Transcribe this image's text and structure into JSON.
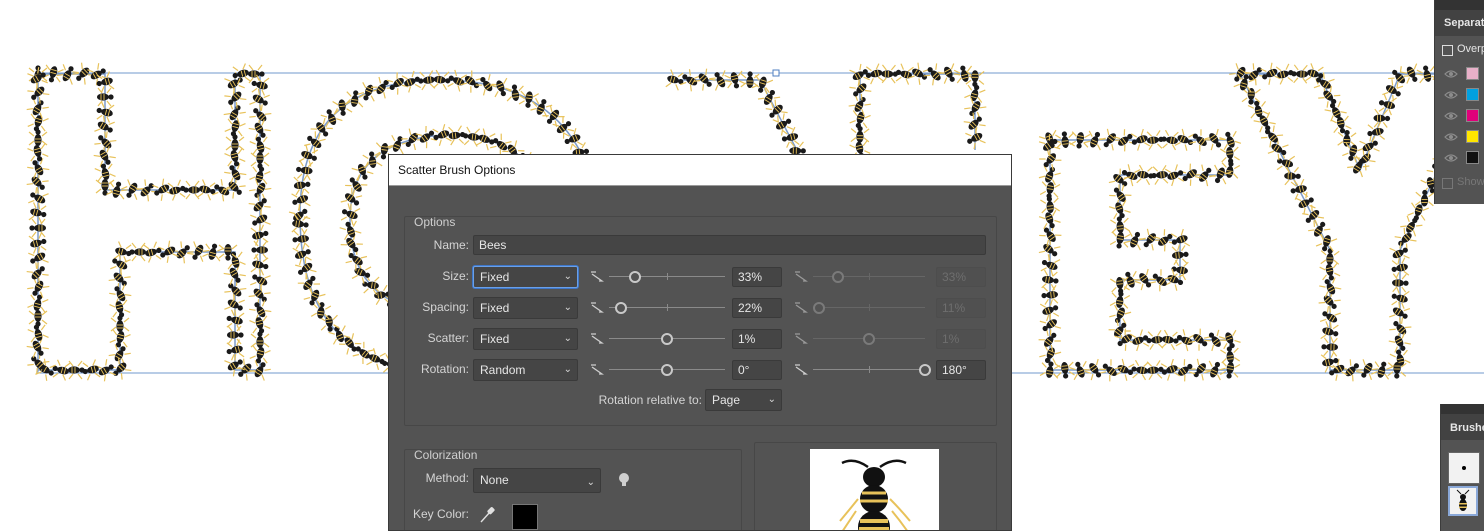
{
  "artwork": {
    "text": "HONEY",
    "stroke_color": "#7d9cc9",
    "bee_color": "#1a1a1a",
    "wing_color": "#e8c25a"
  },
  "dialog": {
    "title": "Scatter Brush Options",
    "options_group": {
      "title": "Options",
      "name_label": "Name:",
      "name_value": "Bees",
      "rows": [
        {
          "label": "Size:",
          "mode": "Fixed",
          "min_value": "33%",
          "max_value": "33%",
          "min_level": 0.22,
          "max_level": 0.22
        },
        {
          "label": "Spacing:",
          "mode": "Fixed",
          "min_value": "22%",
          "max_value": "11%",
          "min_level": 0.1,
          "max_level": 0.05
        },
        {
          "label": "Scatter:",
          "mode": "Fixed",
          "min_value": "1%",
          "max_value": "1%",
          "min_level": 0.5,
          "max_level": 0.5
        },
        {
          "label": "Rotation:",
          "mode": "Random",
          "min_value": "0°",
          "max_value": "180°",
          "min_level": 0.5,
          "max_level": 1.0
        }
      ],
      "rotation_relative_label": "Rotation relative to:",
      "rotation_relative_value": "Page"
    },
    "colorization_group": {
      "title": "Colorization",
      "method_label": "Method:",
      "method_value": "None",
      "key_color_label": "Key Color:",
      "key_color": "#000000"
    }
  },
  "separations_panel": {
    "title": "Separatio",
    "overprint_label": "Overp",
    "show_label": "Show",
    "swatches": [
      "#e8b0c8",
      "#00a0e0",
      "#e0007a",
      "#ffe600",
      "#111111"
    ]
  },
  "brushes_panel": {
    "title": "Brushes"
  }
}
